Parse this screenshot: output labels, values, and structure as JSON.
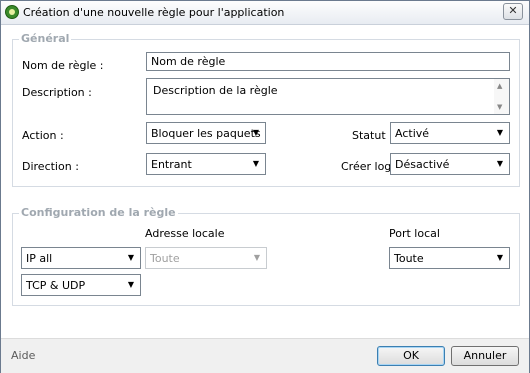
{
  "window": {
    "title": "Création d'une nouvelle règle pour l'application",
    "close_label": "✕"
  },
  "general": {
    "legend": "Général",
    "name_label": "Nom de règle :",
    "name_value": "Nom de règle",
    "description_label": "Description :",
    "description_value": "Description de la règle",
    "action_label": "Action :",
    "action_value": "Bloquer les paquets",
    "status_label": "Statut :",
    "status_value": "Activé",
    "direction_label": "Direction :",
    "direction_value": "Entrant",
    "log_label": "Créer log:",
    "log_value": "Désactivé"
  },
  "config": {
    "legend": "Configuration de la règle",
    "local_address_label": "Adresse locale",
    "local_port_label": "Port local",
    "ip_value": "IP all",
    "local_address_value": "Toute",
    "local_port_value": "Toute",
    "protocol_value": "TCP & UDP"
  },
  "footer": {
    "help_label": "Aide",
    "ok_label": "OK",
    "cancel_label": "Annuler"
  },
  "icons": {
    "dropdown": "▼",
    "scroll_up": "▲",
    "scroll_down": "▼"
  }
}
